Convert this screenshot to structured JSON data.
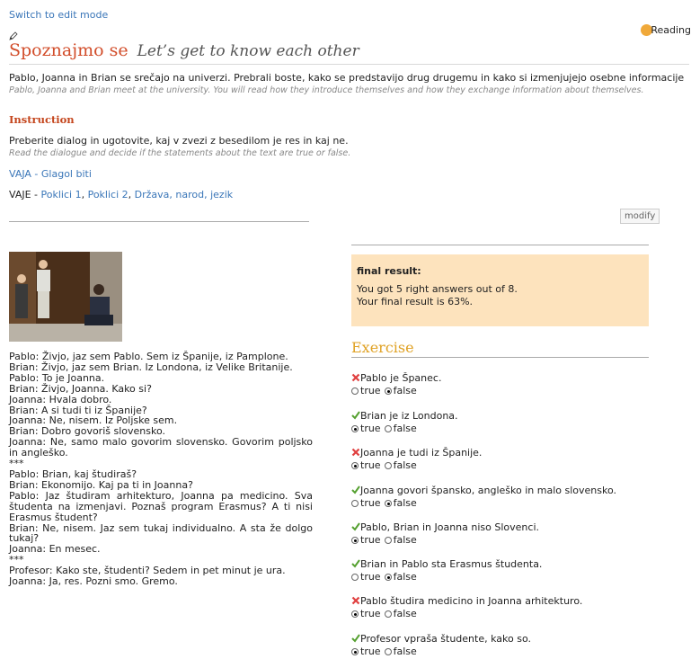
{
  "edit_mode_link": "Switch to edit mode",
  "reading_label": "Reading",
  "title": {
    "sl": "Spoznajmo se",
    "en": "Let’s get to know each other"
  },
  "intro": {
    "sl": "Pablo, Joanna in Brian se srečajo na univerzi. Prebrali boste, kako se predstavijo drug drugemu in kako si izmenjujejo osebne informacije",
    "en": "Pablo, Joanna and Brian meet at the university. You will read how they introduce themselves and how they exchange information about themselves."
  },
  "instruction": {
    "title": "Instruction",
    "sl": "Preberite dialog in ugotovite, kaj v zvezi z besedilom je res in kaj ne.",
    "en": "Read the dialogue and decide if the statements about the text are true or false."
  },
  "vaja": {
    "link": "VAJA - Glagol biti"
  },
  "vaje": {
    "prefix": "VAJE - ",
    "links": [
      "Poklici 1",
      "Poklici 2",
      "Država, narod, jezik"
    ],
    "sep": ", "
  },
  "modify_button": "modify",
  "dialog": [
    "Pablo: Živjo, jaz sem Pablo. Sem iz Španije, iz Pamplone.",
    "Brian: Živjo, jaz sem Brian. Iz Londona, iz Velike Britanije.",
    "Pablo: To je Joanna.",
    "Brian: Živjo, Joanna. Kako si?",
    "Joanna: Hvala dobro.",
    "Brian: A si tudi ti iz Španije?",
    "Joanna: Ne, nisem. Iz Poljske sem.",
    "Brian: Dobro govoriš slovensko.",
    "Joanna: Ne, samo malo govorim slovensko. Govorim poljsko in angleško.",
    "***",
    "Pablo: Brian, kaj študiraš?",
    "Brian: Ekonomijo. Kaj pa ti in Joanna?",
    "Pablo: Jaz študiram arhitekturo, Joanna pa medicino. Sva študenta na izmenjavi. Poznaš program Erasmus? A ti nisi Erasmus študent?",
    "Brian: Ne, nisem. Jaz sem tukaj individualno. A sta že dolgo tukaj?",
    "Joanna: En mesec.",
    "***",
    "Profesor: Kako ste, študenti? Sedem in pet minut je ura.",
    "Joanna: Ja, res. Pozni smo. Gremo."
  ],
  "result": {
    "heading": "final result:",
    "line1": "You got 5 right answers out of 8.",
    "line2": "Your final result is 63%."
  },
  "exercise": {
    "title": "Exercise",
    "true_label": "true",
    "false_label": "false",
    "questions": [
      {
        "text": "Pablo je Španec.",
        "correct": false,
        "selected": "false"
      },
      {
        "text": "Brian je iz Londona.",
        "correct": true,
        "selected": "true"
      },
      {
        "text": "Joanna je tudi iz Španije.",
        "correct": false,
        "selected": "true"
      },
      {
        "text": "Joanna govori špansko, angleško in malo slovensko.",
        "correct": true,
        "selected": "false"
      },
      {
        "text": "Pablo, Brian in Joanna niso Slovenci.",
        "correct": true,
        "selected": "true"
      },
      {
        "text": "Brian in Pablo sta Erasmus študenta.",
        "correct": true,
        "selected": "false"
      },
      {
        "text": "Pablo študira medicino in Joanna arhitekturo.",
        "correct": false,
        "selected": "true"
      },
      {
        "text": "Profesor vpraša študente, kako so.",
        "correct": true,
        "selected": "true"
      }
    ]
  },
  "colors": {
    "title": "#d24d2a",
    "link": "#3a76b8",
    "result_bg": "#fde3bd",
    "exercise_title": "#e0a225",
    "wrong": "#e04040",
    "right": "#55a030"
  }
}
